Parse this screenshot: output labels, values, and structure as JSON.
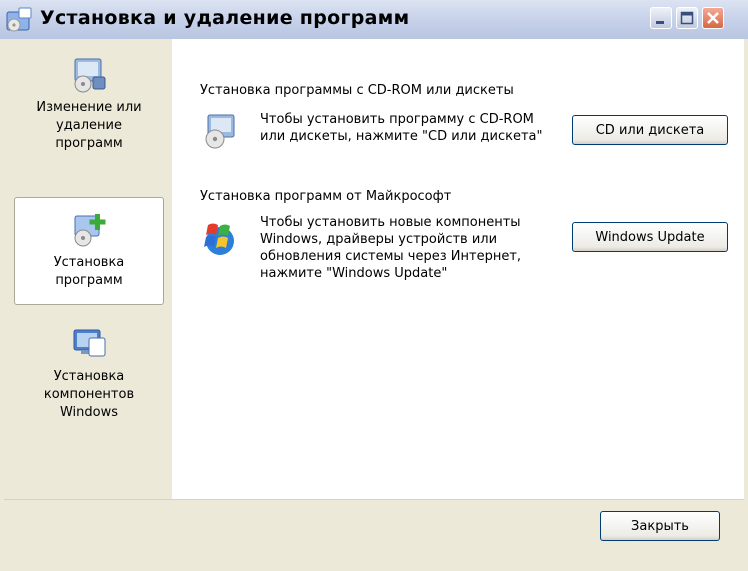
{
  "window": {
    "title": "Установка и удаление программ",
    "close_label": "Закрыть"
  },
  "sidebar": {
    "items": [
      {
        "label": "Изменение или\nудаление\nпрограмм",
        "icon": "change-remove-icon"
      },
      {
        "label": "Установка\nпрограмм",
        "icon": "add-programs-icon",
        "active": true
      },
      {
        "label": "Установка\nкомпонентов\nWindows",
        "icon": "windows-components-icon"
      }
    ]
  },
  "main": {
    "cd": {
      "title": "Установка программы с CD-ROM или дискеты",
      "desc": "Чтобы установить программу с CD-ROM или дискеты, нажмите \"CD или дискета\"",
      "button": "CD или дискета"
    },
    "wu": {
      "title": "Установка программ от Майкрософт",
      "desc": "Чтобы установить новые компоненты Windows, драйверы устройств или обновления системы через Интернет, нажмите \"Windows Update\"",
      "button": "Windows Update"
    }
  },
  "colors": {
    "accent": "#316AC5",
    "close_button": "#D66745",
    "panel": "#ECE9D8"
  }
}
